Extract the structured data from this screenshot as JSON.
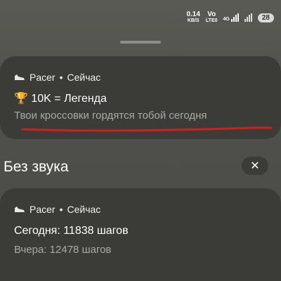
{
  "status": {
    "net_speed": "0.14",
    "net_unit": "KB/S",
    "volte_top": "Vo",
    "volte_bottom": "LTE0",
    "net_type": "4G",
    "battery": "28"
  },
  "notification_1": {
    "app_name": "Pacer",
    "time": "Сейчас",
    "title": "🏆 10K = Легенда",
    "body": "Твои кроссовки гордятся тобой сегодня"
  },
  "section": {
    "title": "Без звука",
    "close_symbol": "✕"
  },
  "notification_2": {
    "app_name": "Pacer",
    "time": "Сейчас",
    "title": "Сегодня: 11838 шагов",
    "body": "Вчера: 12478 шагов"
  },
  "colors": {
    "underline": "#d81c1c",
    "card_bg": "#3b3c38"
  },
  "icons": [
    "shoe-icon",
    "trophy-icon",
    "close-icon",
    "signal-icon"
  ]
}
